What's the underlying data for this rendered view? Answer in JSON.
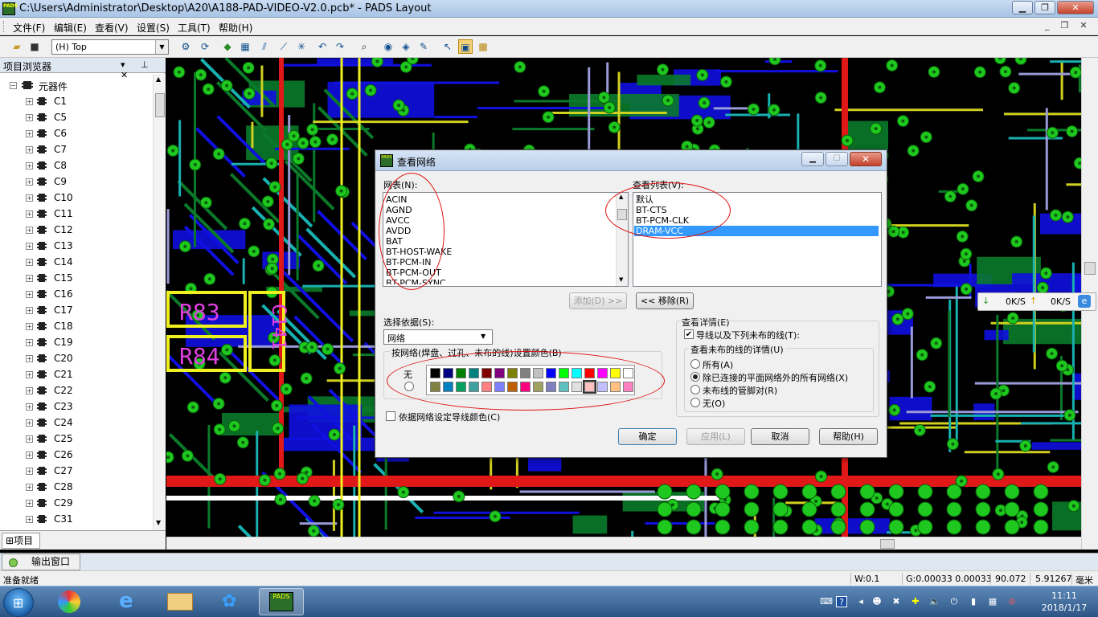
{
  "window": {
    "title": "C:\\Users\\Administrator\\Desktop\\A20\\A188-PAD-VIDEO-V2.0.pcb* - PADS Layout",
    "app_icon_text": "PADS"
  },
  "menu": [
    "文件(F)",
    "编辑(E)",
    "查看(V)",
    "设置(S)",
    "工具(T)",
    "帮助(H)"
  ],
  "toolbar": {
    "layer": "(H) Top"
  },
  "project_browser": {
    "title": "项目浏览器",
    "root": "元器件",
    "components": [
      "C1",
      "C5",
      "C6",
      "C7",
      "C8",
      "C9",
      "C10",
      "C11",
      "C12",
      "C13",
      "C14",
      "C15",
      "C16",
      "C17",
      "C18",
      "C19",
      "C20",
      "C21",
      "C22",
      "C23",
      "C24",
      "C25",
      "C26",
      "C27",
      "C28",
      "C29",
      "C31"
    ],
    "tab": "项目"
  },
  "pcb": {
    "labels": [
      "R83",
      "R84",
      "C141"
    ]
  },
  "net_speed": {
    "down": "0K/S",
    "up": "0K/S"
  },
  "dialog": {
    "title": "查看网络",
    "net_list_label": "网表(N):",
    "nets": [
      "ACIN",
      "AGND",
      "AVCC",
      "AVDD",
      "BAT",
      "BT-HOST-WAKE",
      "BT-PCM-IN",
      "BT-PCM-OUT",
      "BT-PCM-SYNC"
    ],
    "view_list_label": "查看列表(V):",
    "view_list": [
      "默认",
      "BT-CTS",
      "BT-PCM-CLK",
      "DRAM-VCC"
    ],
    "view_list_selected": "DRAM-VCC",
    "add_button": "添加(D) >>",
    "remove_button": "<< 移除(R)",
    "select_by_label": "选择依据(S):",
    "select_by_value": "网络",
    "color_group_label": "按网络(焊盘、过孔、未布的线)设置颜色(B)",
    "none_label": "无",
    "colors_row1": [
      "#000000",
      "#000080",
      "#008000",
      "#008080",
      "#800000",
      "#800080",
      "#808000",
      "#808080",
      "#c0c0c0",
      "#0000ff",
      "#00ff00",
      "#00ffff",
      "#ff0000",
      "#ff00ff",
      "#ffff00",
      "#ffffff"
    ],
    "colors_row2": [
      "#808040",
      "#0080c0",
      "#00a060",
      "#40a0a0",
      "#ff8080",
      "#8080ff",
      "#c06000",
      "#ff0080",
      "#a0a060",
      "#8080c0",
      "#60c0c0",
      "#e0e0e0",
      "#ffc0c0",
      "#c0c0ff",
      "#ffc080",
      "#ff80c0"
    ],
    "wire_color_checkbox": "依据网络设定导线颜色(C)",
    "view_details_label": "查看详情(E)",
    "traces_checkbox": "导线以及下列未布的线(T):",
    "unrouted_group_label": "查看未布的线的详情(U)",
    "radio_options": [
      "所有(A)",
      "除已连接的平面网络外的所有网络(X)",
      "未布线的管脚对(R)",
      "无(O)"
    ],
    "radio_selected": "除已连接的平面网络外的所有网络(X)",
    "ok": "确定",
    "apply": "应用(L)",
    "cancel": "取消",
    "help": "帮助(H)"
  },
  "output_window": "输出窗口",
  "status": {
    "ready": "准备就绪",
    "width": "W:0.1",
    "grid": "G:0.00033 0.00033",
    "x": "90.072",
    "y": "5.91267",
    "unit": "毫米"
  },
  "clock": {
    "time": "11:11",
    "date": "2018/1/17"
  }
}
